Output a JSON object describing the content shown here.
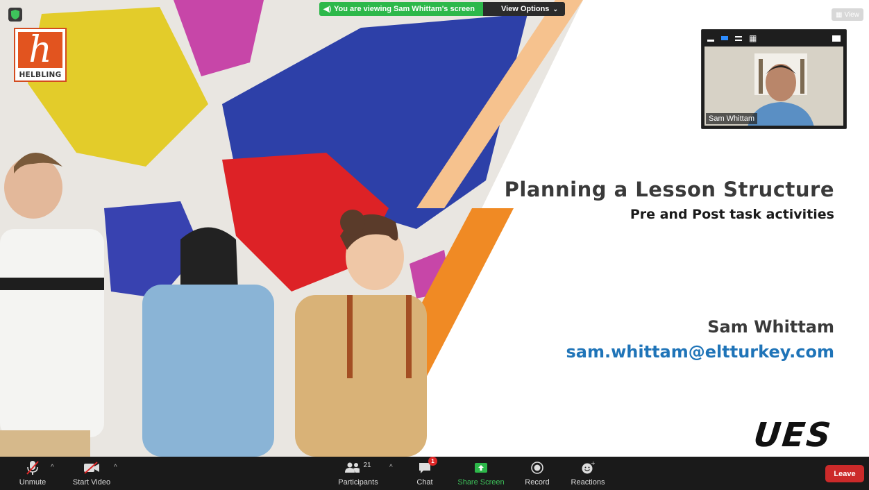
{
  "banner": {
    "text": "You are viewing Sam Whittam's screen",
    "view_options": "View Options"
  },
  "view_button": {
    "label": "View"
  },
  "slide": {
    "title": "Planning a Lesson Structure",
    "subtitle": "Pre and Post task activities",
    "presenter": "Sam Whittam",
    "email": "sam.whittam@eltturkey.com",
    "brand_logo": "HELBLING",
    "ues_logo": "UES"
  },
  "camera": {
    "name": "Sam Whittam"
  },
  "toolbar": {
    "unmute": "Unmute",
    "start_video": "Start Video",
    "participants": "Participants",
    "participant_count": "21",
    "chat": "Chat",
    "chat_badge": "1",
    "share_screen": "Share Screen",
    "record": "Record",
    "reactions": "Reactions",
    "leave": "Leave"
  },
  "colors": {
    "banner_green": "#2db84a",
    "accent_orange": "#f08a24",
    "email_blue": "#1f74b8",
    "leave_red": "#cc2a2a"
  },
  "icons": [
    "shield-icon",
    "mic-muted-icon",
    "video-off-icon",
    "participants-icon",
    "chat-icon",
    "share-screen-icon",
    "record-icon",
    "reactions-icon",
    "grid-icon"
  ]
}
